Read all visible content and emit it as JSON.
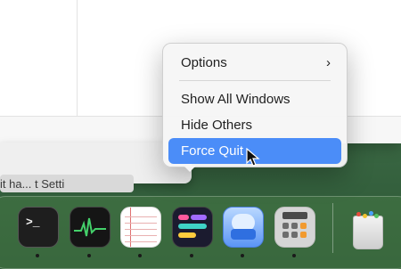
{
  "window_background": {
    "partial_title": "it ha... t Setti"
  },
  "context_menu": {
    "items": [
      {
        "label": "Options",
        "has_submenu": true
      },
      {
        "label": "Show All Windows"
      },
      {
        "label": "Hide Others"
      },
      {
        "label": "Force Quit",
        "selected": true
      }
    ],
    "submenu_icon": "chevron-right-icon"
  },
  "dock": {
    "apps": [
      {
        "name": "Terminal",
        "icon": "terminal-icon",
        "running": true,
        "glyph": ">_"
      },
      {
        "name": "Activity Monitor",
        "icon": "activity-monitor-icon",
        "running": true
      },
      {
        "name": "TextEdit",
        "icon": "textedit-icon",
        "running": true
      },
      {
        "name": "Shortcuts",
        "icon": "shortcuts-icon",
        "running": true
      },
      {
        "name": "Drive",
        "icon": "drive-icon",
        "running": true
      },
      {
        "name": "Calculator",
        "icon": "calculator-icon",
        "running": true
      },
      {
        "name": "Trash",
        "icon": "trash-icon",
        "running": false
      }
    ]
  },
  "colors": {
    "selection": "#4b8df8",
    "wallpaper": "#3c6a45"
  }
}
